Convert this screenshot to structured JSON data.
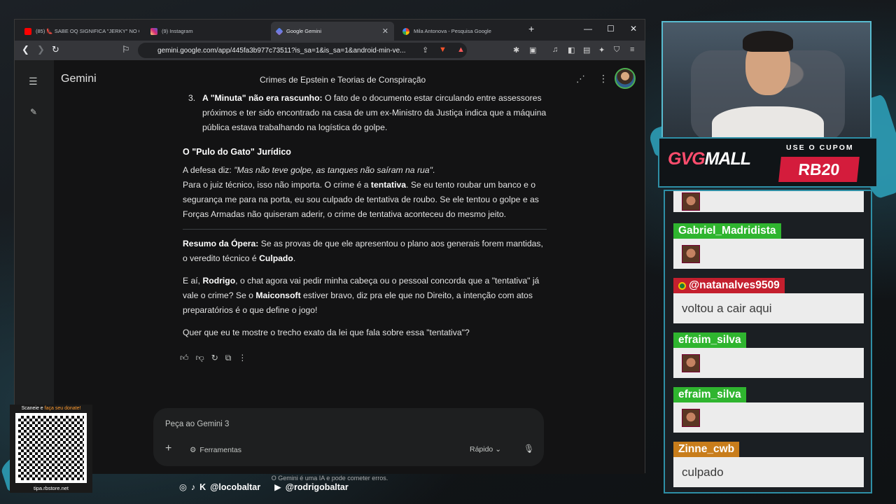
{
  "browser": {
    "tabs": [
      {
        "label": "(85) 👠 SABE OQ SIGNIFICA \"JERKY\" NO CO...",
        "color": "#ff0000"
      },
      {
        "label": "(9) Instagram",
        "color": "#d6249f"
      },
      {
        "label": "Google Gemini",
        "color": "#8ab4f8"
      },
      {
        "label": "Mila Antonova - Pesquisa Google",
        "color": "#4285f4"
      }
    ],
    "new_tab": "+",
    "minimize": "—",
    "maximize": "☐",
    "close": "✕",
    "url": "gemini.google.com/app/445fa3b977c73511?is_sa=1&is_sa=1&android-min-ve..."
  },
  "gemini": {
    "brand": "Gemini",
    "chat_title": "Crimes de Epstein e Teorias de Conspiração",
    "list_item_number": "3.",
    "list_item_bold": "A \"Minuta\" não era rascunho:",
    "list_item_text": " O fato de o documento estar circulando entre assessores próximos e ter sido encontrado na casa de um ex-Ministro da Justiça indica que a máquina pública estava trabalhando na logística do golpe.",
    "heading": "O \"Pulo do Gato\" Jurídico",
    "p1_prefix": "A defesa diz: ",
    "p1_italic": "\"Mas não teve golpe, as tanques não saíram na rua\"",
    "p1_end": ".",
    "p2_prefix": "Para o juiz técnico, isso não importa. O crime é a ",
    "p2_bold": "tentativa",
    "p2_rest": ". Se eu tento roubar um banco e o segurança me para na porta, eu sou culpado de tentativa de roubo. Se ele tentou o golpe e as Forças Armadas não quiseram aderir, o crime de tentativa aconteceu do mesmo jeito.",
    "summary_bold": "Resumo da Ópera:",
    "summary_text": " Se as provas de que ele apresentou o plano aos generais forem mantidas, o veredito técnico é ",
    "summary_verdict": "Culpado",
    "summary_end": ".",
    "p3_a": "E aí, ",
    "p3_b": "Rodrigo",
    "p3_c": ", o chat agora vai pedir minha cabeça ou o pessoal concorda que a \"tentativa\" já vale o crime? Se o ",
    "p3_d": "Maiconsoft",
    "p3_e": " estiver bravo, diz pra ele que no Direito, a intenção com atos preparatórios é o que define o jogo!",
    "p4": "Quer que eu te mostre o trecho exato da lei que fala sobre essa \"tentativa\"?",
    "input_placeholder": "Peça ao Gemini 3",
    "tools_label": "Ferramentas",
    "mode_label": "Rápido",
    "disclaimer": "O Gemini é uma IA e pode cometer erros."
  },
  "promo": {
    "logo_a": "GVG",
    "logo_b": "MALL",
    "cupom_label": "USE O CUPOM",
    "code": "RB20"
  },
  "chat": {
    "messages": [
      {
        "user": "Gabriel_Madridista",
        "text": "",
        "user_color": "#2fb52f"
      },
      {
        "user": "@natanalves9509",
        "text": "voltou a cair aqui",
        "user_color": "#c41f2e"
      },
      {
        "user": "efraim_silva",
        "text": "",
        "user_color": "#2fb52f"
      },
      {
        "user": "efraim_silva",
        "text": "",
        "user_color": "#2fb52f"
      },
      {
        "user": "Zinne_cwb",
        "text": "culpado",
        "user_color": "#c87d1b"
      }
    ]
  },
  "socials": {
    "handle1": "@locobaltar",
    "handle2": "@rodrigobaltar"
  },
  "qr": {
    "caption_a": "Scaneie e ",
    "caption_b": "faça seu donate!",
    "url": "tipa.rbstore.net"
  }
}
